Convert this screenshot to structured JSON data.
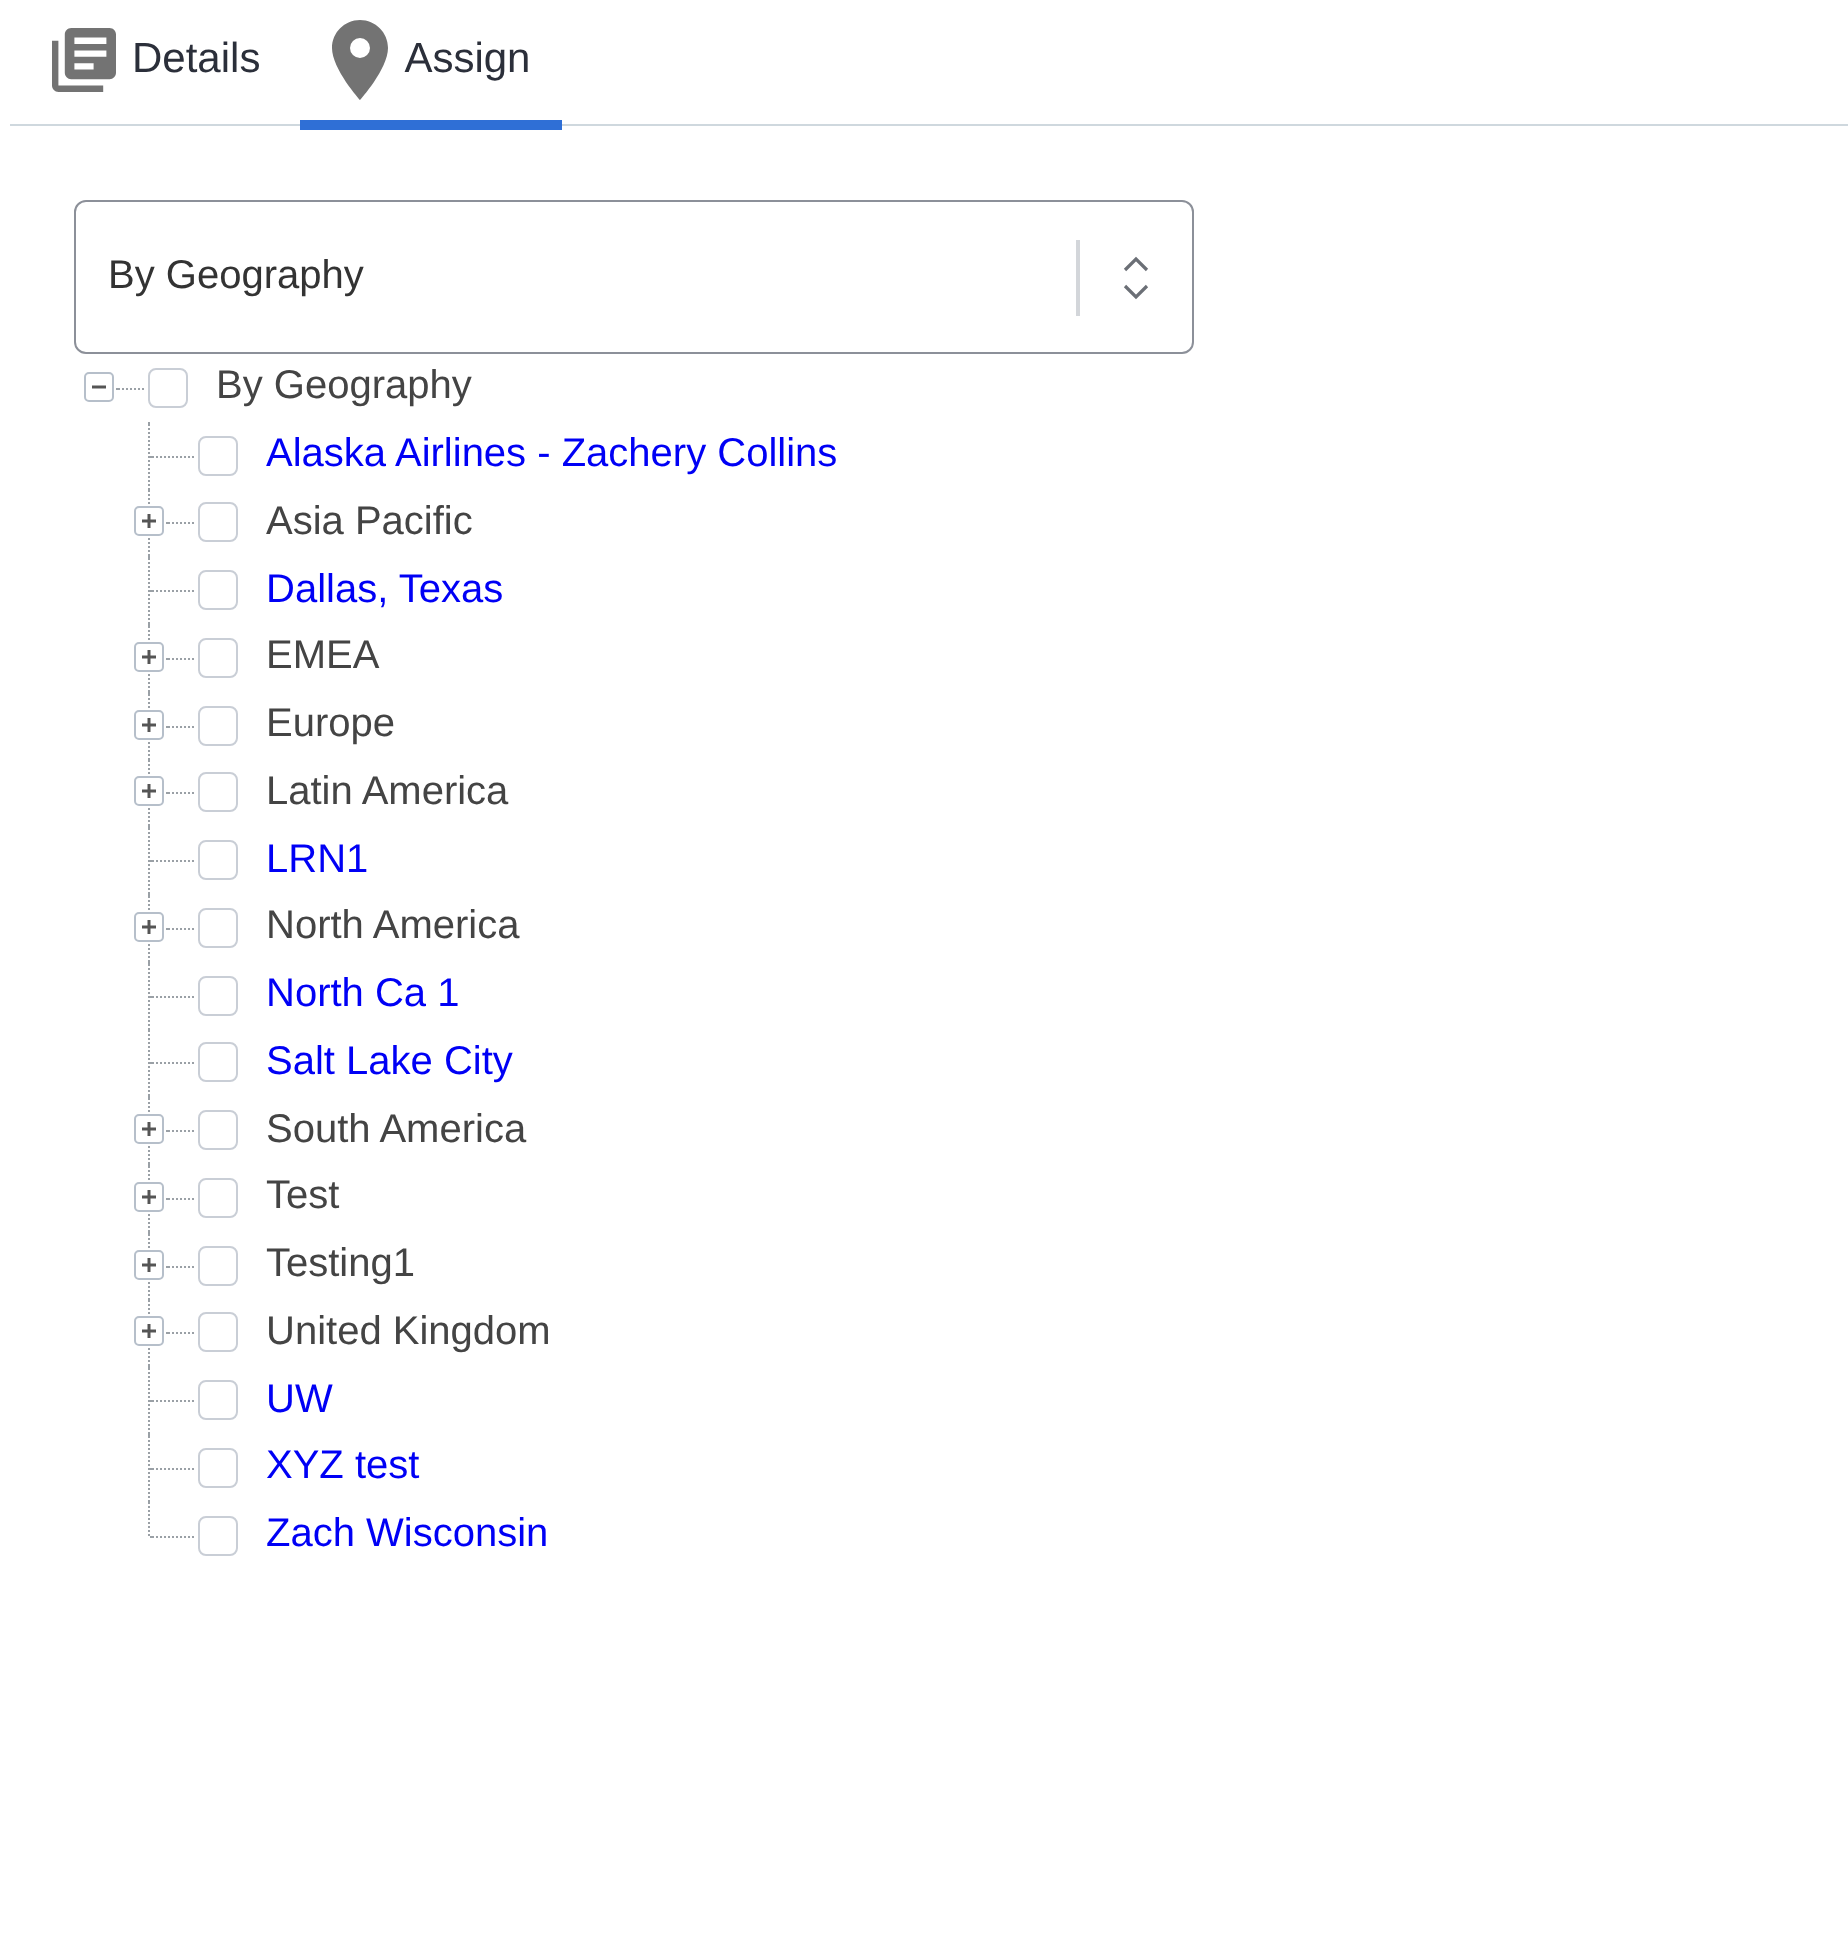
{
  "tabs": [
    {
      "label": "Details",
      "selected": false
    },
    {
      "label": "Assign",
      "selected": true
    }
  ],
  "grouping_select": {
    "value": "By Geography"
  },
  "tree": {
    "label": "By Geography",
    "kind": "group",
    "checked": false,
    "expanded": true,
    "children": [
      {
        "label": "Alaska Airlines - Zachery Collins",
        "kind": "leaf",
        "checked": false
      },
      {
        "label": "Asia Pacific",
        "kind": "group",
        "checked": false,
        "expanded": false
      },
      {
        "label": "Dallas, Texas",
        "kind": "leaf",
        "checked": false
      },
      {
        "label": "EMEA",
        "kind": "group",
        "checked": false,
        "expanded": false
      },
      {
        "label": "Europe",
        "kind": "group",
        "checked": false,
        "expanded": false
      },
      {
        "label": "Latin America",
        "kind": "group",
        "checked": false,
        "expanded": false
      },
      {
        "label": "LRN1",
        "kind": "leaf",
        "checked": false
      },
      {
        "label": "North America",
        "kind": "group",
        "checked": false,
        "expanded": false
      },
      {
        "label": "North Ca 1",
        "kind": "leaf",
        "checked": false
      },
      {
        "label": "Salt Lake City",
        "kind": "leaf",
        "checked": false
      },
      {
        "label": "South America",
        "kind": "group",
        "checked": false,
        "expanded": false
      },
      {
        "label": "Test",
        "kind": "group",
        "checked": false,
        "expanded": false
      },
      {
        "label": "Testing1",
        "kind": "group",
        "checked": false,
        "expanded": false
      },
      {
        "label": "United Kingdom",
        "kind": "group",
        "checked": false,
        "expanded": false
      },
      {
        "label": "UW",
        "kind": "leaf",
        "checked": false
      },
      {
        "label": "XYZ test",
        "kind": "leaf",
        "checked": false
      },
      {
        "label": "Zach Wisconsin",
        "kind": "leaf",
        "checked": false
      }
    ]
  }
}
